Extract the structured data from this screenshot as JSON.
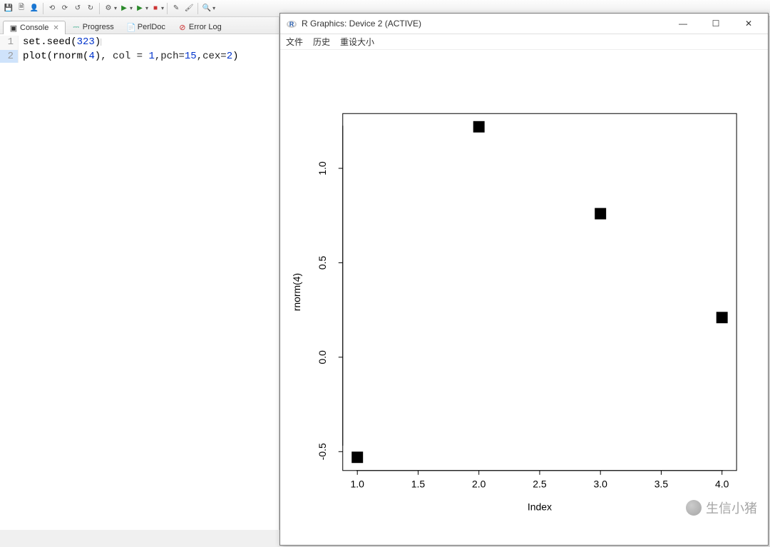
{
  "toolbar_icons": [
    "save",
    "save-all",
    "avatar",
    "sep",
    "run1",
    "run2",
    "run3",
    "run4",
    "sep",
    "gear",
    "dd",
    "play",
    "dd",
    "play-red",
    "dd",
    "stop",
    "dd",
    "sep",
    "pencil",
    "brush",
    "sep",
    "search",
    "dd"
  ],
  "tabs": [
    {
      "label": "Console",
      "active": true,
      "icon": "console"
    },
    {
      "label": "Progress",
      "active": false,
      "icon": "progress"
    },
    {
      "label": "PerlDoc",
      "active": false,
      "icon": "perldoc"
    },
    {
      "label": "Error Log",
      "active": false,
      "icon": "errorlog"
    }
  ],
  "code": {
    "lines": [
      {
        "n": "1",
        "text": "set.seed(323)",
        "sel": false,
        "cursor": true
      },
      {
        "n": "2",
        "text": "plot(rnorm(4), col = 1,pch=15,cex=2)",
        "sel": true,
        "cursor": false
      }
    ]
  },
  "graphics_window": {
    "title": "R Graphics: Device 2 (ACTIVE)",
    "menu": [
      "文件",
      "历史",
      "重设大小"
    ]
  },
  "chart_data": {
    "type": "scatter",
    "x": [
      1,
      2,
      3,
      4
    ],
    "y": [
      -0.53,
      1.22,
      0.76,
      0.21
    ],
    "xlabel": "Index",
    "ylabel": "rnorm(4)",
    "xticks": [
      1.0,
      1.5,
      2.0,
      2.5,
      3.0,
      3.5,
      4.0
    ],
    "yticks": [
      -0.5,
      0.0,
      0.5,
      1.0
    ],
    "xlim": [
      0.88,
      4.12
    ],
    "ylim": [
      -0.6,
      1.29
    ],
    "pch": 15,
    "cex": 2,
    "col": "black"
  },
  "watermark": "生信小猪"
}
